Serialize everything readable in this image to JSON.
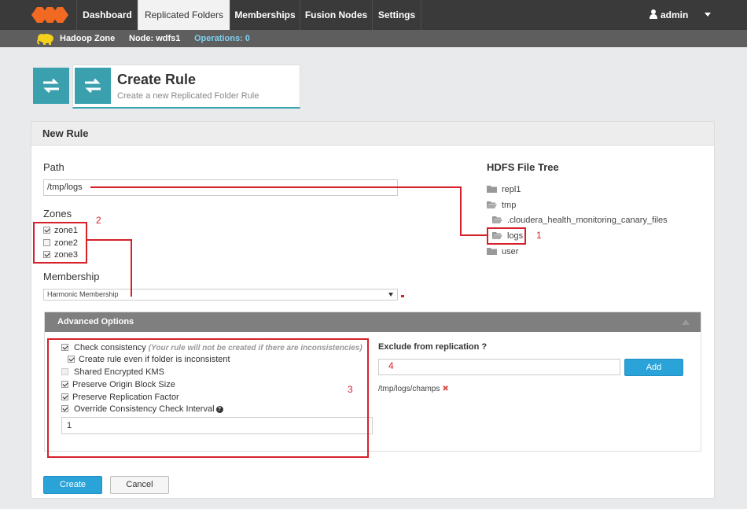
{
  "nav": {
    "tabs": [
      {
        "label": "Dashboard"
      },
      {
        "label": "Replicated Folders"
      },
      {
        "label": "Memberships"
      },
      {
        "label": "Fusion Nodes"
      },
      {
        "label": "Settings"
      }
    ],
    "user": "admin"
  },
  "subbar": {
    "zone": "Hadoop Zone",
    "node": "Node: wdfs1",
    "operations": "Operations: 0"
  },
  "header": {
    "title": "Create Rule",
    "subtitle": "Create a new Replicated Folder Rule"
  },
  "panel": {
    "title": "New Rule",
    "path_label": "Path",
    "path_value": "/tmp/logs",
    "zones_label": "Zones",
    "zones": [
      {
        "label": "zone1",
        "checked": true
      },
      {
        "label": "zone2",
        "checked": false
      },
      {
        "label": "zone3",
        "checked": true
      }
    ],
    "membership_label": "Membership",
    "membership_value": "Harmonic Membership"
  },
  "tree": {
    "title": "HDFS File Tree",
    "items": [
      {
        "label": "repl1"
      },
      {
        "label": "tmp"
      },
      {
        "label": ".cloudera_health_monitoring_canary_files"
      },
      {
        "label": "logs"
      },
      {
        "label": "user"
      }
    ]
  },
  "advanced": {
    "title": "Advanced Options",
    "check_consistency": "Check consistency",
    "check_consistency_hint": "(Your rule will not be created if there are inconsistencies)",
    "create_if_inconsistent": "Create rule even if folder is inconsistent",
    "shared_kms": "Shared Encrypted KMS",
    "preserve_block": "Preserve Origin Block Size",
    "preserve_replication": "Preserve Replication Factor",
    "override_interval": "Override Consistency Check Interval",
    "interval_value": "1",
    "exclude_label": "Exclude from replication ?",
    "add_label": "Add",
    "excluded": [
      "/tmp/logs/champs"
    ]
  },
  "actions": {
    "create": "Create",
    "cancel": "Cancel"
  },
  "annotations": {
    "n1": "1",
    "n2": "2",
    "n3": "3",
    "n4": "4"
  },
  "colors": {
    "accent": "#3aa0ae",
    "primary_button": "#2aa3d9",
    "annotation": "#d6212b",
    "nav_bg": "#3a3a3a"
  }
}
